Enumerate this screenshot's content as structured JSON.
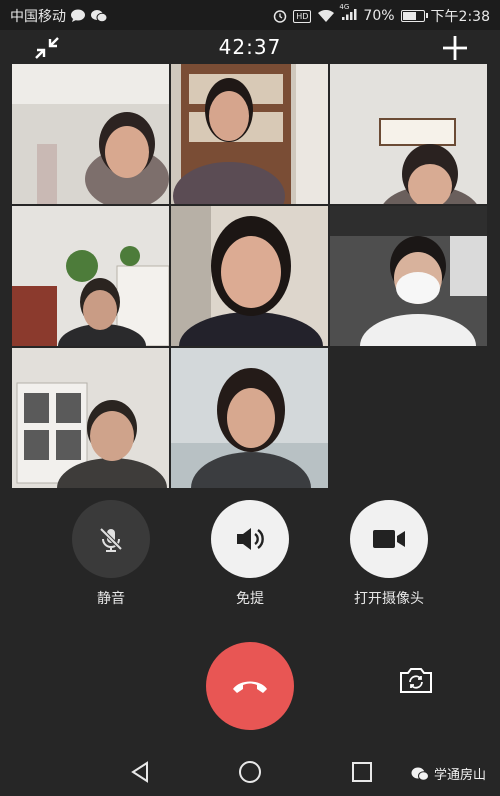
{
  "status_bar": {
    "carrier": "中国移动",
    "battery_percent": "70%",
    "battery_level": 0.7,
    "time": "下午2:38",
    "network_label": "4G"
  },
  "call": {
    "duration": "42:37"
  },
  "participants": [
    {
      "id": "p1"
    },
    {
      "id": "p2"
    },
    {
      "id": "p3"
    },
    {
      "id": "p4"
    },
    {
      "id": "p5"
    },
    {
      "id": "p6"
    },
    {
      "id": "p7"
    },
    {
      "id": "p8"
    }
  ],
  "controls": {
    "mute_label": "静音",
    "speaker_label": "免提",
    "camera_label": "打开摄像头"
  },
  "watermark": {
    "text": "学通房山"
  },
  "colors": {
    "background": "#262626",
    "hangup": "#e85654",
    "button_light": "#f1f1f1",
    "button_dark": "#3a3a3a"
  }
}
